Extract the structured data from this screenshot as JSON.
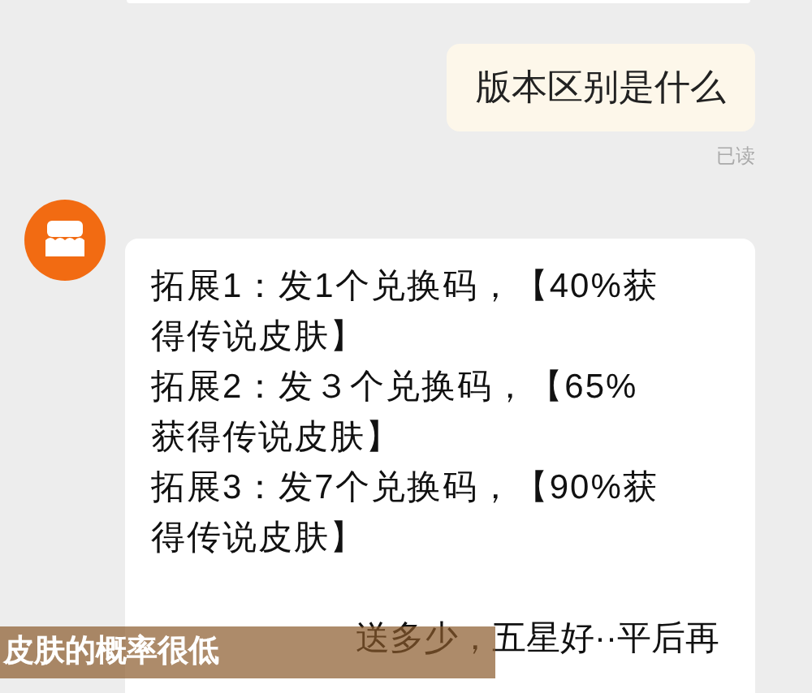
{
  "messages": [
    {
      "kind": "sent",
      "text": "版本区别是什么",
      "status": "已读"
    },
    {
      "kind": "received",
      "paragraphs": [
        "拓展1：发1个兑换码，【40%获得传说皮肤】",
        "拓展2：发３个兑换码，【65%获得传说皮肤】",
        "拓展3：发7个兑换码，【90%获得传说皮肤】",
        "送多少，五星好··平后再"
      ]
    }
  ],
  "caption": "皮肤的概率很低"
}
